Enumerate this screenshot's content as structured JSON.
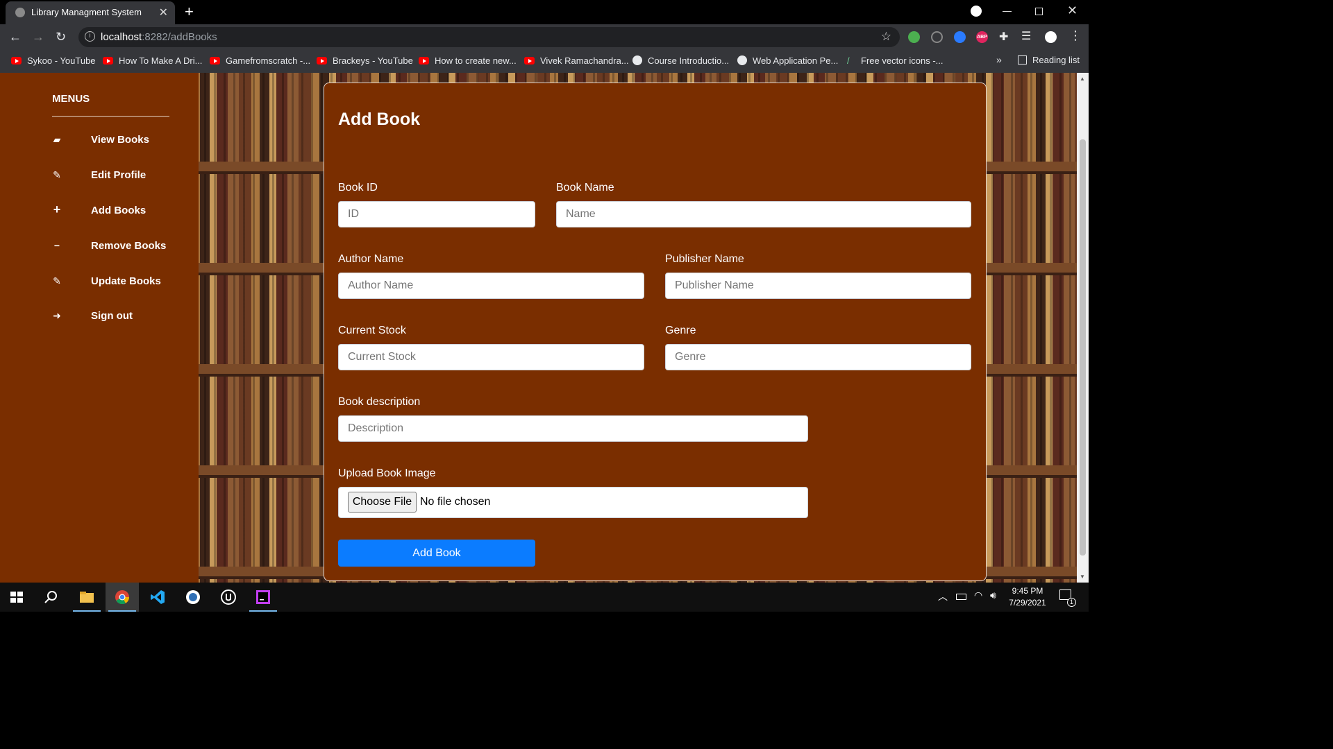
{
  "browser": {
    "tab_title": "Library Managment System",
    "tab_close": "✕",
    "new_tab": "+",
    "url_host": "localhost",
    "url_path": ":8282/addBooks",
    "bookmarks": [
      {
        "label": "Sykoo - YouTube",
        "icon": "youtube-icon"
      },
      {
        "label": "How To Make A Dri...",
        "icon": "youtube-icon"
      },
      {
        "label": "Gamefromscratch -...",
        "icon": "youtube-icon"
      },
      {
        "label": "Brackeys - YouTube",
        "icon": "youtube-icon"
      },
      {
        "label": "How to create new...",
        "icon": "youtube-icon"
      },
      {
        "label": "Vivek Ramachandra...",
        "icon": "youtube-icon"
      },
      {
        "label": "Course Introductio...",
        "icon": "globe-icon"
      },
      {
        "label": "Web Application Pe...",
        "icon": "globe-icon"
      },
      {
        "label": "Free vector icons -...",
        "icon": "pen-icon"
      }
    ],
    "bookmarks_more": "»",
    "reading_list": "Reading list",
    "ext_abp": "ABP"
  },
  "sidebar": {
    "title": "MENUS",
    "items": [
      {
        "label": "View Books",
        "icon": "book-icon"
      },
      {
        "label": "Edit Profile",
        "icon": "edit-icon"
      },
      {
        "label": "Add Books",
        "icon": "plus-icon"
      },
      {
        "label": "Remove Books",
        "icon": "minus-icon"
      },
      {
        "label": "Update Books",
        "icon": "edit-icon"
      },
      {
        "label": "Sign out",
        "icon": "sign-out-icon"
      }
    ]
  },
  "form": {
    "title": "Add Book",
    "book_id": {
      "label": "Book ID",
      "placeholder": "ID"
    },
    "book_name": {
      "label": "Book Name",
      "placeholder": "Name"
    },
    "author_name": {
      "label": "Author Name",
      "placeholder": "Author Name"
    },
    "publisher_name": {
      "label": "Publisher Name",
      "placeholder": "Publisher Name"
    },
    "current_stock": {
      "label": "Current Stock",
      "placeholder": "Current Stock"
    },
    "genre": {
      "label": "Genre",
      "placeholder": "Genre"
    },
    "description": {
      "label": "Book description",
      "placeholder": "Description"
    },
    "upload": {
      "label": "Upload Book Image",
      "button": "Choose File",
      "status": "No file chosen"
    },
    "submit": "Add Book"
  },
  "taskbar": {
    "time": "9:45 PM",
    "date": "7/29/2021",
    "notification_count": "1"
  },
  "colors": {
    "sidebar_bg": "#7a2e00",
    "card_bg": "#7a2e00",
    "primary_button": "#0b7cff"
  }
}
